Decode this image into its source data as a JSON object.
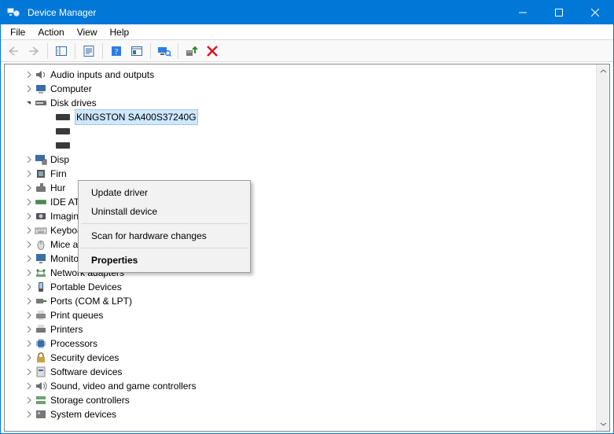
{
  "window": {
    "title": "Device Manager"
  },
  "menubar": [
    {
      "label": "File"
    },
    {
      "label": "Action"
    },
    {
      "label": "View"
    },
    {
      "label": "Help"
    }
  ],
  "tree": {
    "selected_child": "KINGSTON SA400S37240G",
    "categories": [
      {
        "label": "Audio inputs and outputs",
        "expanded": false,
        "icon": "speaker"
      },
      {
        "label": "Computer",
        "expanded": false,
        "icon": "computer"
      },
      {
        "label": "Disk drives",
        "expanded": true,
        "icon": "drive",
        "children": [
          {
            "label": "KINGSTON SA400S37240G",
            "selected": true
          },
          {
            "label": "",
            "selected": false
          },
          {
            "label": "",
            "selected": false
          }
        ]
      },
      {
        "label": "Disp",
        "trunc": true,
        "icon": "display"
      },
      {
        "label": "Firn",
        "trunc": true,
        "icon": "chip"
      },
      {
        "label": "Hur",
        "trunc": true,
        "icon": "hid"
      },
      {
        "label": "IDE ATA/ATAPI controllers",
        "icon": "ide"
      },
      {
        "label": "Imaging devices",
        "icon": "imaging"
      },
      {
        "label": "Keyboards",
        "icon": "keyboard"
      },
      {
        "label": "Mice and other pointing devices",
        "icon": "mouse"
      },
      {
        "label": "Monitors",
        "icon": "monitor"
      },
      {
        "label": "Network adapters",
        "icon": "network"
      },
      {
        "label": "Portable Devices",
        "icon": "portable"
      },
      {
        "label": "Ports (COM & LPT)",
        "icon": "ports"
      },
      {
        "label": "Print queues",
        "icon": "printqueue"
      },
      {
        "label": "Printers",
        "icon": "printer"
      },
      {
        "label": "Processors",
        "icon": "cpu"
      },
      {
        "label": "Security devices",
        "icon": "security"
      },
      {
        "label": "Software devices",
        "icon": "software"
      },
      {
        "label": "Sound, video and game controllers",
        "icon": "sound"
      },
      {
        "label": "Storage controllers",
        "icon": "storage"
      },
      {
        "label": "System devices",
        "trunc_bottom": true,
        "icon": "system"
      }
    ]
  },
  "context_menu": [
    {
      "label": "Update driver",
      "bold": false
    },
    {
      "label": "Uninstall device",
      "bold": false
    },
    {
      "sep": true
    },
    {
      "label": "Scan for hardware changes",
      "bold": false
    },
    {
      "sep": true
    },
    {
      "label": "Properties",
      "bold": true
    }
  ]
}
